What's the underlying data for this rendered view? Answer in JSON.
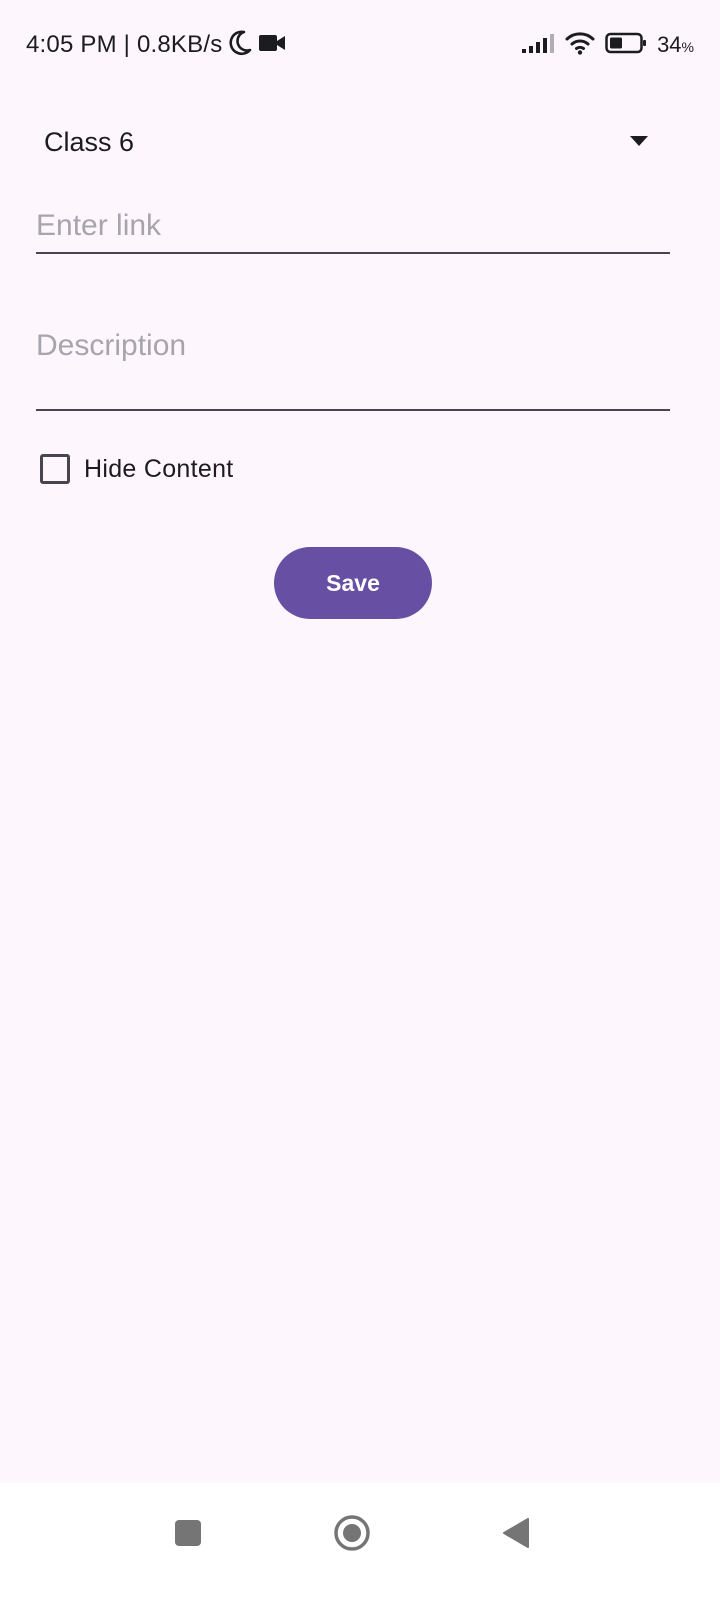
{
  "status_bar": {
    "time": "4:05 PM | 0.8KB/s",
    "icons": [
      "moon-icon",
      "video-camera-icon",
      "signal-icon",
      "wifi-icon",
      "battery-icon"
    ],
    "battery_level": "34",
    "battery_unit": "%"
  },
  "form": {
    "class_dropdown": {
      "selected": "Class 6",
      "icon": "dropdown-arrow-icon"
    },
    "link_input": {
      "placeholder": "Enter link",
      "value": ""
    },
    "description_input": {
      "placeholder": "Description",
      "value": ""
    },
    "hide_content": {
      "label": "Hide Content",
      "checked": false
    },
    "save_label": "Save"
  },
  "nav_bar": {
    "icons": [
      "recents-square-icon",
      "home-circle-icon",
      "back-triangle-icon"
    ]
  },
  "colors": {
    "background": "#FDF7FD",
    "primary": "#6750A4",
    "on_primary": "#FFFFFF",
    "text": "#1C1B1F",
    "placeholder": "#A8A4AE",
    "outline": "#49454F",
    "nav_icon": "#757575"
  }
}
